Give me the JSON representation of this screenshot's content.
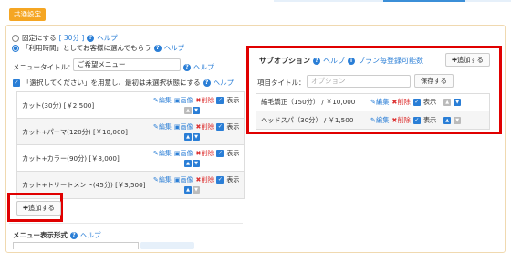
{
  "common_tag": "共通設定",
  "radio": {
    "fixed_label": "固定にする",
    "fixed_value": "[ 30分 ]",
    "help": "ヘルプ",
    "choose_label": "「利用時間」としてお客様に選んでもらう"
  },
  "menu_title": {
    "label": "メニュータイトル：",
    "value": "ご希望メニュー",
    "help": "ヘルプ"
  },
  "unselected": {
    "label": "「選択してください」を用意し、最初は未選択状態にする",
    "help": "ヘルプ"
  },
  "actions": {
    "edit": "編集",
    "image": "画像",
    "delete": "削除",
    "show": "表示"
  },
  "menu_items": [
    {
      "name": "カット(30分) [￥2,500]",
      "up": false,
      "down": true
    },
    {
      "name": "カット+パーマ(120分) [￥10,000]",
      "up": true,
      "down": true
    },
    {
      "name": "カット+カラー(90分) [￥8,000]",
      "up": true,
      "down": true
    },
    {
      "name": "カット+トリートメント(45分) [￥3,500]",
      "up": true,
      "down": false
    }
  ],
  "add_button": "✚追加する",
  "suboption": {
    "title": "サブオプション",
    "help": "ヘルプ",
    "plan_note": "プラン毎登録可能数",
    "add_button": "✚追加する",
    "item_title_label": "項目タイトル：",
    "item_title_placeholder": "オプション",
    "save_button": "保存する",
    "rows": [
      {
        "name": "縮毛矯正（150分） / ￥10,000"
      },
      {
        "name": "ヘッドスパ（30分） / ￥1,500"
      }
    ]
  },
  "display_format": {
    "label": "メニュー表示形式",
    "help": "ヘルプ"
  }
}
